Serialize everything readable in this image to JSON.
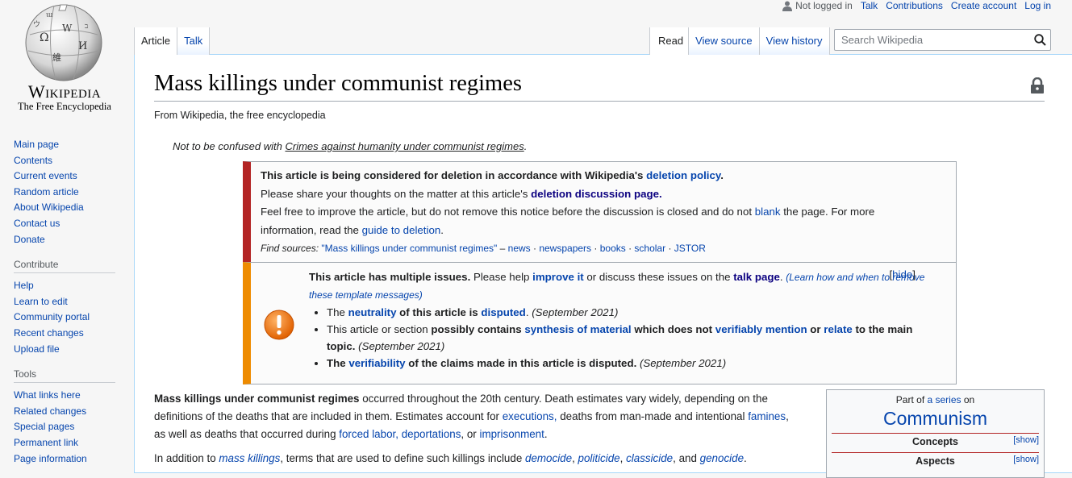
{
  "logo": {
    "wordmark": "Wikipedia",
    "tagline": "The Free Encyclopedia"
  },
  "personal_tools": {
    "status": "Not logged in",
    "links": [
      "Talk",
      "Contributions",
      "Create account",
      "Log in"
    ]
  },
  "namespace_tabs": [
    {
      "label": "Article",
      "selected": true
    },
    {
      "label": "Talk",
      "selected": false
    }
  ],
  "view_tabs": [
    {
      "label": "Read",
      "selected": true
    },
    {
      "label": "View source",
      "selected": false
    },
    {
      "label": "View history",
      "selected": false
    }
  ],
  "search": {
    "placeholder": "Search Wikipedia",
    "value": ""
  },
  "sidebar": {
    "navigation": [
      "Main page",
      "Contents",
      "Current events",
      "Random article",
      "About Wikipedia",
      "Contact us",
      "Donate"
    ],
    "contribute": {
      "heading": "Contribute",
      "items": [
        "Help",
        "Learn to edit",
        "Community portal",
        "Recent changes",
        "Upload file"
      ]
    },
    "tools": {
      "heading": "Tools",
      "items": [
        "What links here",
        "Related changes",
        "Special pages",
        "Permanent link",
        "Page information"
      ]
    }
  },
  "article": {
    "title": "Mass killings under communist regimes",
    "site_sub": "From Wikipedia, the free encyclopedia",
    "hatnote": {
      "prefix": "Not to be confused with ",
      "link": "Crimes against humanity under communist regimes",
      "suffix": "."
    }
  },
  "deletion_box": {
    "line1_bold": "This article is being considered for deletion in accordance with Wikipedia's ",
    "line1_link": "deletion policy",
    "line1_end": ".",
    "line2_text": "Please share your thoughts on the matter at this article's ",
    "line2_link": "deletion discussion page.",
    "line3_text1": "Feel free to improve the article, but do not remove this notice before the discussion is closed and do not ",
    "line3_link": "blank",
    "line3_text2": " the page. For more",
    "line4_text": "information, read the ",
    "line4_link": "guide to deletion",
    "line4_end": ".",
    "find_sources_label": "Find sources: ",
    "find_sources_query": "\"Mass killings under communist regimes\"",
    "find_sources_links": [
      "news",
      "newspapers",
      "books",
      "scholar",
      "JSTOR"
    ]
  },
  "issues_box": {
    "intro_bold": "This article has multiple issues.",
    "intro_text1": " Please help ",
    "intro_link1": "improve it",
    "intro_text2": " or discuss these issues on the ",
    "intro_link2": "talk page",
    "intro_text3": ". ",
    "learn_link": "(Learn how and when to remove these template messages)",
    "hide_label": "hide",
    "items": [
      {
        "pre": "The ",
        "link1": "neutrality",
        "mid": " of this article is ",
        "link2": "disputed",
        "post": ".",
        "date": "(September 2021)"
      },
      {
        "pre": "This article or section ",
        "bold": "possibly contains ",
        "link1": "synthesis of material",
        "mid": " which does not ",
        "link2": "verifiably mention",
        "mid2": " or ",
        "link3": "relate",
        "post": " to the main topic.",
        "date": "(September 2021)"
      },
      {
        "pre": "The ",
        "link1": "verifiability",
        "post": " of the claims made in this article is disputed.",
        "date": "(September 2021)"
      }
    ]
  },
  "body": {
    "p1": {
      "bold": "Mass killings under communist regimes",
      "t1": " occurred throughout the 20th century. Death estimates vary widely, depending on the definitions of the deaths that are included in them. Estimates account for ",
      "l1": "executions,",
      "t2": " deaths from man-made and intentional ",
      "l2": "famines",
      "t3": ", as well as deaths that occurred during ",
      "l3": "forced labor,",
      "t4": " ",
      "l4": "deportations",
      "t5": ", or ",
      "l5": "imprisonment",
      "t6": "."
    },
    "p2": {
      "t1": "In addition to ",
      "l1": "mass killings",
      "t2": ", terms that are used to define such killings include ",
      "l2": "democide",
      "t3": ", ",
      "l3": "politicide",
      "t4": ", ",
      "l4": "classicide",
      "t5": ", and ",
      "l5": "genocide",
      "t6": "."
    }
  },
  "navbox": {
    "part_of": "Part of ",
    "part_of_link": "a series",
    "part_of_suffix": " on",
    "title": "Communism",
    "sections": [
      {
        "label": "Concepts",
        "toggle": "[show]"
      },
      {
        "label": "Aspects",
        "toggle": "[show]"
      }
    ]
  },
  "colors": {
    "link": "#0645ad",
    "visited_link": "#0b0080",
    "delete_stripe": "#b32424",
    "issues_stripe": "#ee8b00",
    "issue_icon": "#f28500"
  }
}
